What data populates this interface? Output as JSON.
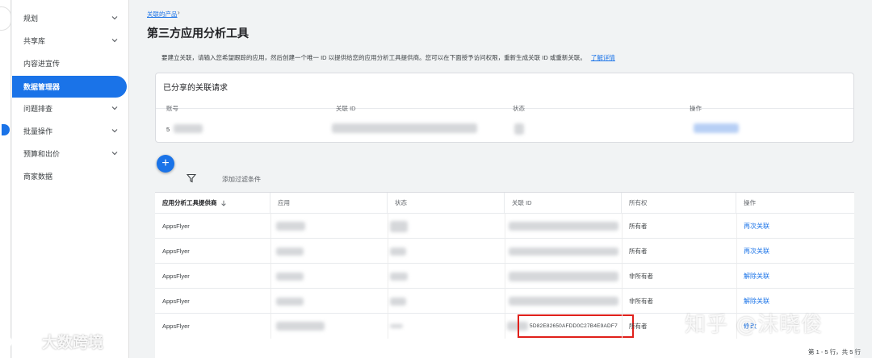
{
  "sidebar": {
    "items": [
      {
        "label": "规划",
        "has_chevron": true
      },
      {
        "label": "共享库",
        "has_chevron": true
      },
      {
        "label": "内容进宣传",
        "has_chevron": false
      },
      {
        "label": "数据管理器",
        "has_chevron": false,
        "active": true
      },
      {
        "label": "问题排查",
        "has_chevron": true
      },
      {
        "label": "批量操作",
        "has_chevron": true
      },
      {
        "label": "预算和出价",
        "has_chevron": true
      },
      {
        "label": "商家数据",
        "has_chevron": false
      }
    ]
  },
  "breadcrumb": {
    "parent": "关联的产品",
    "separator": "›"
  },
  "page": {
    "title": "第三方应用分析工具",
    "description": "要建立关联，请输入您希望跟踪的应用，然后创建一个唯一 ID 以提供给您的应用分析工具提供商。您可以在下面授予访问权限，重新生成关联 ID 或重新关联。",
    "learn_more": "了解详情"
  },
  "shared_requests": {
    "title": "已分享的关联请求",
    "columns": [
      "账号",
      "关联 ID",
      "状态",
      "操作"
    ],
    "row_visible_prefix": "5"
  },
  "toolbar": {
    "add_icon": "plus-icon",
    "filter_icon": "filter-icon",
    "filter_label": "添加过滤条件"
  },
  "table": {
    "columns": [
      "应用分析工具提供商",
      "应用",
      "状态",
      "关联 ID",
      "所有权",
      "操作"
    ],
    "sort_icon": "arrow-down-icon",
    "rows": [
      {
        "provider": "AppsFlyer",
        "ownership": "所有者",
        "action": "再次关联"
      },
      {
        "provider": "AppsFlyer",
        "ownership": "所有者",
        "action": "再次关联"
      },
      {
        "provider": "AppsFlyer",
        "ownership": "非所有者",
        "action": "解除关联"
      },
      {
        "provider": "AppsFlyer",
        "ownership": "非所有者",
        "action": "解除关联"
      },
      {
        "provider": "AppsFlyer",
        "ownership": "所有者",
        "action": "修改",
        "link_id": "5D82E82650AFDD0C27B4E9ADF7"
      }
    ]
  },
  "pagination": "第 1 - 5 行，共 5 行",
  "watermarks": {
    "right": "知乎 @沫晓俊",
    "left": "大数跨境"
  },
  "colors": {
    "accent": "#1a73e8",
    "highlight": "#e0201b",
    "background": "#f1f3f4"
  }
}
